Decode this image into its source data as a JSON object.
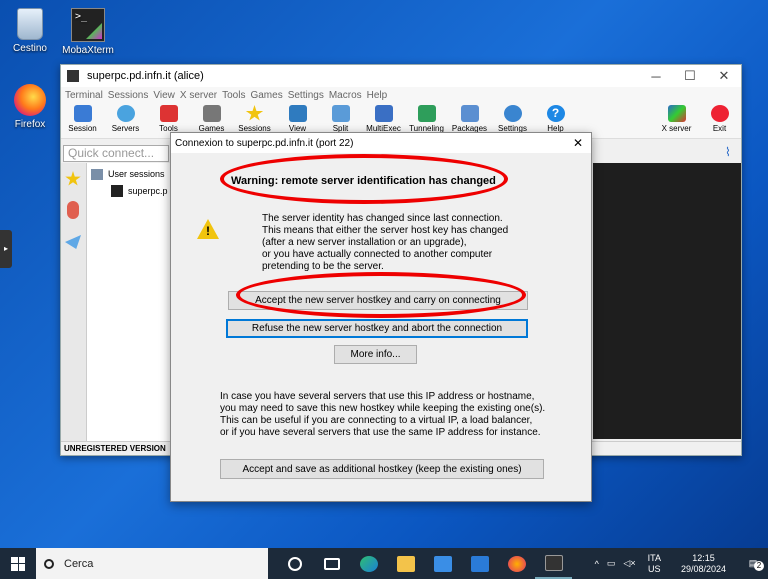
{
  "desktop": {
    "icons": [
      {
        "label": "Cestino",
        "icon": "recycle-bin-icon"
      },
      {
        "label": "MobaXterm",
        "icon": "mobaxterm-icon"
      },
      {
        "label": "Firefox",
        "icon": "firefox-icon"
      }
    ]
  },
  "window": {
    "title": "superpc.pd.infn.it (alice)",
    "menu": [
      "Terminal",
      "Sessions",
      "View",
      "X server",
      "Tools",
      "Games",
      "Settings",
      "Macros",
      "Help"
    ],
    "toolbar": [
      "Session",
      "Servers",
      "Tools",
      "Games",
      "Sessions",
      "View",
      "Split",
      "MultiExec",
      "Tunneling",
      "Packages",
      "Settings",
      "Help"
    ],
    "toolbar_right": [
      "X server",
      "Exit"
    ],
    "quick_connect_placeholder": "Quick connect...",
    "tree": {
      "group": "User sessions",
      "item": "superpc.p"
    },
    "status": "UNREGISTERED VERSION"
  },
  "dialog": {
    "title": "Connexion to superpc.pd.infn.it (port 22)",
    "heading": "Warning: remote server identification has changed",
    "body": [
      "The server identity has changed since last connection.",
      "This means that either the server host key has changed",
      "(after a new server installation or an upgrade),",
      "or you have actually connected to another computer",
      "pretending to be the server."
    ],
    "accept_button": "Accept the new server hostkey and carry on connecting",
    "refuse_button": "Refuse the new server hostkey and abort the connection",
    "more_button": "More info...",
    "body2": [
      "In case you have several servers that use this IP address or hostname,",
      "you may need to save this new hostkey while keeping the existing one(s).",
      "This can be useful if you are connecting to a virtual IP, a load balancer,",
      "or if you have several servers that use the same IP address for instance."
    ],
    "save_button": "Accept and save as additional hostkey (keep the existing ones)"
  },
  "taskbar": {
    "search_placeholder": "Cerca",
    "lang1": "ITA",
    "lang2": "US",
    "time": "12:15",
    "date": "29/08/2024",
    "notifications": "2"
  },
  "colors": {
    "annotation": "#e00000",
    "desktop": "#1a6fd8",
    "taskbar": "#1c2a3a"
  }
}
